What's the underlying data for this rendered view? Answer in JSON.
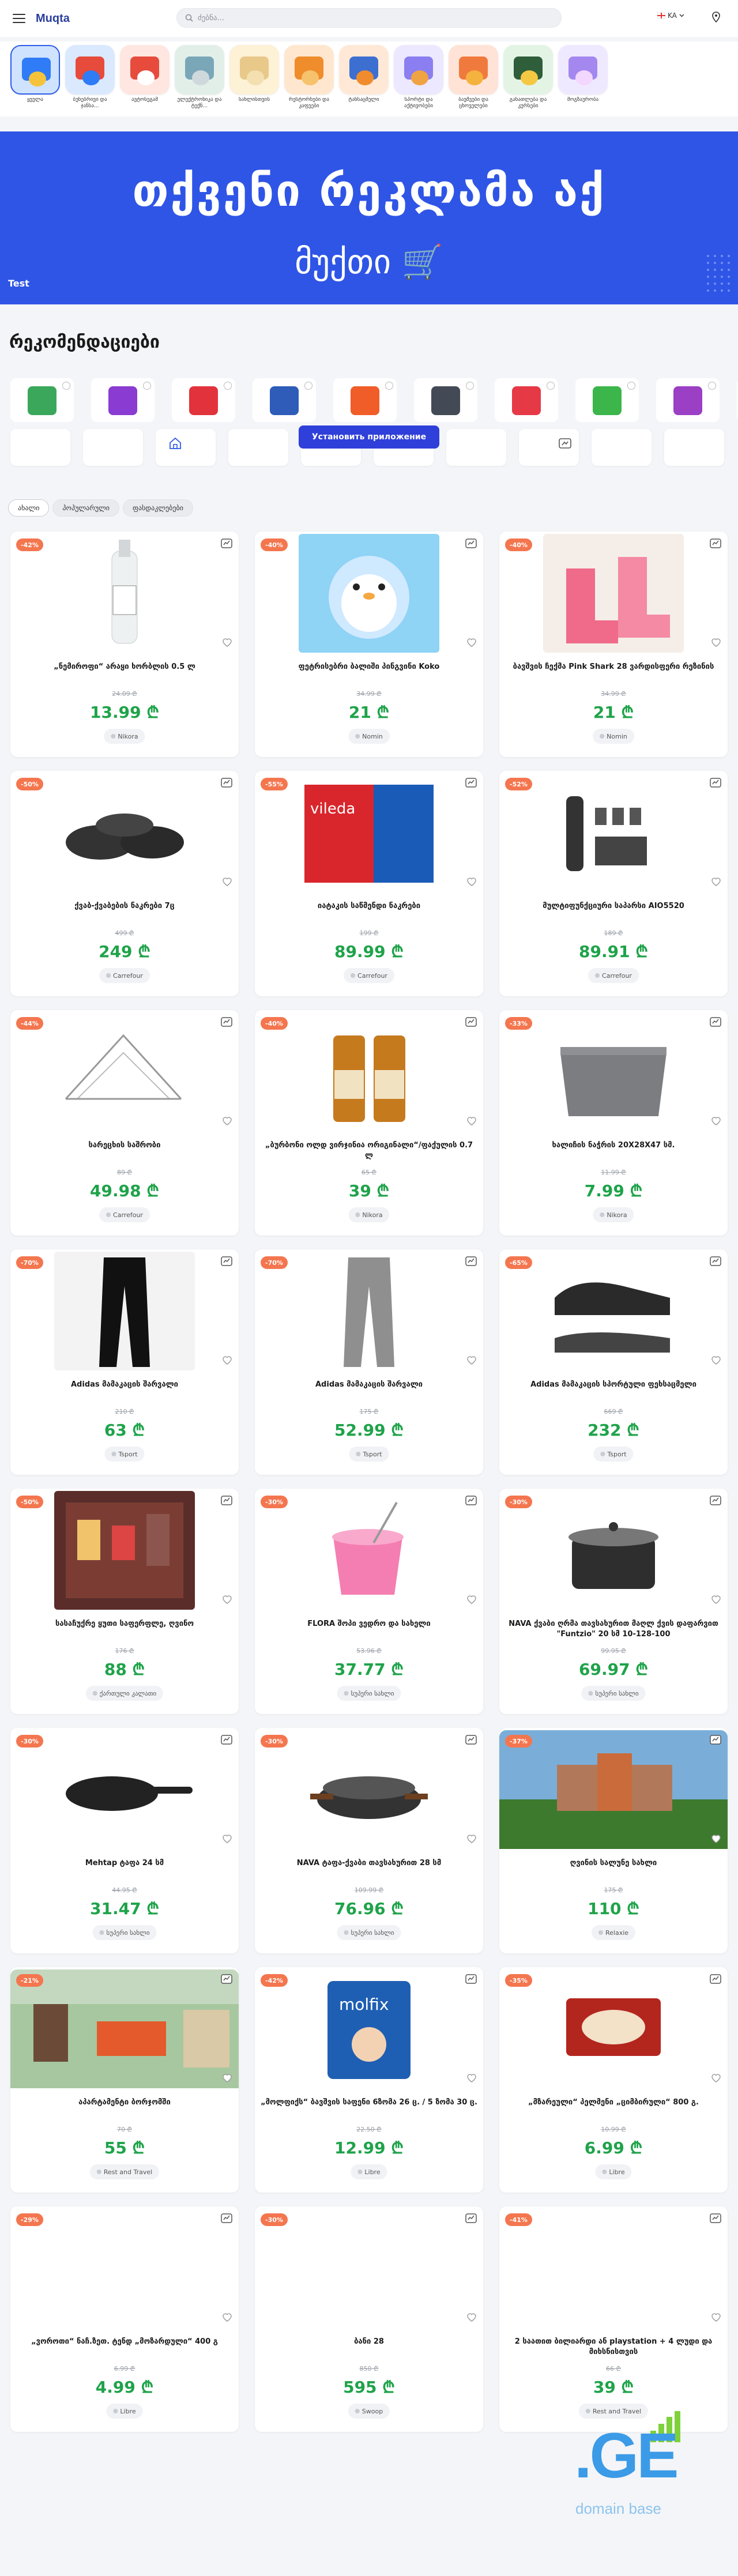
{
  "header": {
    "logo": "Muqta",
    "search_placeholder": "ძებნა...",
    "language": "KA"
  },
  "categories": [
    {
      "label": "ყველა",
      "color": "#cfe3ff",
      "c1": "#2f7cf6",
      "c2": "#f5c33b",
      "active": true
    },
    {
      "label": "ბუნებრივი და ჯანსა...",
      "color": "#dbe9ff",
      "c1": "#e64b3c",
      "c2": "#2f7cf6"
    },
    {
      "label": "ავტოსეგამ",
      "color": "#ffe6e1",
      "c1": "#e64b3c",
      "c2": "#ffffff"
    },
    {
      "label": "ელექტრონიკა და ტექნ...",
      "color": "#e2efe9",
      "c1": "#7aa7b8",
      "c2": "#cfd8dc"
    },
    {
      "label": "სახლისთვის",
      "color": "#fdf1d6",
      "c1": "#e8c98a",
      "c2": "#f3dfb0"
    },
    {
      "label": "რესტორნები და კაფეები",
      "color": "#ffe7cf",
      "c1": "#ef8c2b",
      "c2": "#f6c26c"
    },
    {
      "label": "ტანსაცმელი",
      "color": "#ffe9d6",
      "c1": "#3d6fd1",
      "c2": "#f08c2e"
    },
    {
      "label": "სპორტი და აქტივობები",
      "color": "#ece8ff",
      "c1": "#8a7ef0",
      "c2": "#f0a342"
    },
    {
      "label": "ბავშვები და ცხოველები",
      "color": "#ffe3d7",
      "c1": "#f07a3d",
      "c2": "#f4b23f"
    },
    {
      "label": "განათლება და კურსები",
      "color": "#e3f4e5",
      "c1": "#2f5e3a",
      "c2": "#f4c842"
    },
    {
      "label": "მოგზაურობა",
      "color": "#efe9ff",
      "c1": "#a488f0",
      "c2": "#f4d7ff"
    }
  ],
  "banner": {
    "line1": "თქვენი რეკლამა აქ",
    "line2": "მუქთი 🛒",
    "tag": "Test"
  },
  "recommendations_title": "რეკომენდაციები",
  "recommendation_logos": [
    {
      "color": "#3aa75b"
    },
    {
      "color": "#8a3bd1"
    },
    {
      "color": "#e2323c"
    },
    {
      "color": "#2e5cb8"
    },
    {
      "color": "#f05d29"
    },
    {
      "color": "#444a55"
    },
    {
      "color": "#e63946"
    },
    {
      "color": "#3cb54a"
    },
    {
      "color": "#9b3fc4"
    },
    {
      "color": "#3cb54a"
    }
  ],
  "install_button": "Установить приложение",
  "filters": [
    {
      "label": "ახალი",
      "active": true
    },
    {
      "label": "პოპულარული",
      "active": false
    },
    {
      "label": "ფასდაკლებები",
      "active": false
    }
  ],
  "products": [
    {
      "discount": "-42%",
      "title": "„ნემიროფი“ არაყი ხორბლის 0.5 ლ",
      "old": "24.09 ₾",
      "price": "13.99 ₾",
      "store": "Nikora",
      "img": "bottle"
    },
    {
      "discount": "-40%",
      "title": "ფეტრისებრი ბალიში პინგვინი Koko",
      "old": "34.99 ₾",
      "price": "21 ₾",
      "store": "Nomin",
      "img": "toy"
    },
    {
      "discount": "-40%",
      "title": "ბავშვის ჩექმა Pink Shark 28 ვარდისფერი რეზინის",
      "old": "34.99 ₾",
      "price": "21 ₾",
      "store": "Nomin",
      "img": "boots"
    },
    {
      "discount": "-50%",
      "title": "ქვაბ-ქვაბების ნაკრები 7ც",
      "old": "499 ₾",
      "price": "249 ₾",
      "store": "Carrefour",
      "img": "pots"
    },
    {
      "discount": "-55%",
      "title": "იატაკის საწმენდი ნაკრები",
      "old": "199 ₾",
      "price": "89.99 ₾",
      "store": "Carrefour",
      "img": "mop"
    },
    {
      "discount": "-52%",
      "title": "მულტიფუნქციური საპარსი AIO5520",
      "old": "189 ₾",
      "price": "89.91 ₾",
      "store": "Carrefour",
      "img": "shaver"
    },
    {
      "discount": "-44%",
      "title": "სარეცხის საშრობი",
      "old": "89 ₾",
      "price": "49.98 ₾",
      "store": "Carrefour",
      "img": "dryer"
    },
    {
      "discount": "-40%",
      "title": "„ბურბონი ოლდ ვირჯინია ორიგინალი“/ფაქულის 0.7 ლ",
      "old": "65 ₾",
      "price": "39 ₾",
      "store": "Nikora",
      "img": "whisky"
    },
    {
      "discount": "-33%",
      "title": "ხალიჩის ნაჭრის 20X28X47 სმ.",
      "old": "11.99 ₾",
      "price": "7.99 ₾",
      "store": "Nikora",
      "img": "basket"
    },
    {
      "discount": "-70%",
      "title": "Adidas მამაკაცის შარვალი",
      "old": "210 ₾",
      "price": "63 ₾",
      "store": "Tsport",
      "img": "pants-black"
    },
    {
      "discount": "-70%",
      "title": "Adidas მამაკაცის შარვალი",
      "old": "175 ₾",
      "price": "52.99 ₾",
      "store": "Tsport",
      "img": "pants-grey"
    },
    {
      "discount": "-65%",
      "title": "Adidas მამაკაცის სპორტული ფეხსაცმელი",
      "old": "669 ₾",
      "price": "232 ₾",
      "store": "Tsport",
      "img": "shoes"
    },
    {
      "discount": "-50%",
      "title": "სასაჩუქრე ყუთი საფერფლე, ღვინო",
      "old": "176 ₾",
      "price": "88 ₾",
      "store": "ქართული კალათი",
      "img": "giftbox"
    },
    {
      "discount": "-30%",
      "title": "FLORA შოპი ვედრო და სახელი",
      "old": "53.96 ₾",
      "price": "37.77 ₾",
      "store": "სუპერი სახლი",
      "img": "bucket"
    },
    {
      "discount": "-30%",
      "title": "NAVA ქვაბი ღრმა თავსახურით მაღლ ქვის დაფარვით \"Funtzio\" 20 სმ 10-128-100",
      "old": "99.95 ₾",
      "price": "69.97 ₾",
      "store": "სუპერი სახლი",
      "img": "pot"
    },
    {
      "discount": "-30%",
      "title": "Mehtap ტაფა 24 სმ",
      "old": "44.95 ₾",
      "price": "31.47 ₾",
      "store": "სუპერი სახლი",
      "img": "pan"
    },
    {
      "discount": "-30%",
      "title": "NAVA ტაფა-ქვაბი თავსახურით 28 სმ",
      "old": "109.99 ₾",
      "price": "76.96 ₾",
      "store": "სუპერი სახლი",
      "img": "saute"
    },
    {
      "discount": "-37%",
      "title": "ღვინის სალუნე სახლი",
      "old": "175 ₾",
      "price": "110 ₾",
      "store": "Relaxie",
      "img": "house",
      "wide": true
    },
    {
      "discount": "-21%",
      "title": "აპარტამენტი ბორჯომში",
      "old": "70 ₾",
      "price": "55 ₾",
      "store": "Rest and Travel",
      "img": "room",
      "wide": true
    },
    {
      "discount": "-42%",
      "title": "„მოლფიქს“ ბავშვის საფენი 6ზომა 26 ც. / 5 ზომა 30 ც.",
      "old": "22.50 ₾",
      "price": "12.99 ₾",
      "store": "Libre",
      "img": "diapers"
    },
    {
      "discount": "-35%",
      "title": "„მზარეული“ პელმენი „ციმბირული“ 800 გ.",
      "old": "10.99 ₾",
      "price": "6.99 ₾",
      "store": "Libre",
      "img": "dumplings"
    },
    {
      "discount": "-29%",
      "title": "„ვოროთი“ ნაჩ.ზეთ. ტენდ „მოზარდული“ 400 გ",
      "old": "6.99 ₾",
      "price": "4.99 ₾",
      "store": "Libre",
      "img": "none"
    },
    {
      "discount": "-30%",
      "title": "ბანი 28",
      "old": "850 ₾",
      "price": "595 ₾",
      "store": "Swoop",
      "img": "none"
    },
    {
      "discount": "-41%",
      "title": "2 საათით ბილიარდი ან playstation + 4 ლუდი და მიხსნისთვის",
      "old": "66 ₾",
      "price": "39 ₾",
      "store": "Rest and Travel",
      "img": "none"
    }
  ],
  "footer_logo": {
    "text": ".GE",
    "sub": "domain base"
  }
}
